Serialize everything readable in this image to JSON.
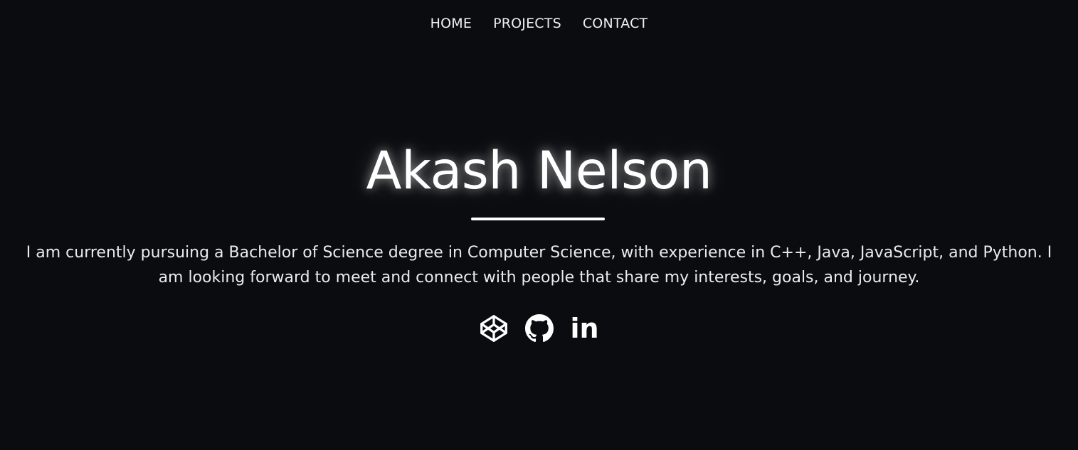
{
  "nav": {
    "items": [
      {
        "label": "HOME"
      },
      {
        "label": "PROJECTS"
      },
      {
        "label": "CONTACT"
      }
    ]
  },
  "hero": {
    "name": "Akash Nelson",
    "bio": "I am currently pursuing a Bachelor of Science degree in Computer Science, with experience in C++, Java, JavaScript, and Python. I am looking forward to meet and connect with people that share my interests, goals, and journey."
  },
  "socials": {
    "items": [
      {
        "icon": "codepen-icon"
      },
      {
        "icon": "github-icon"
      },
      {
        "icon": "linkedin-icon",
        "text": "in"
      }
    ]
  },
  "colors": {
    "background": "#0b0c0f",
    "text": "#ffffff"
  }
}
